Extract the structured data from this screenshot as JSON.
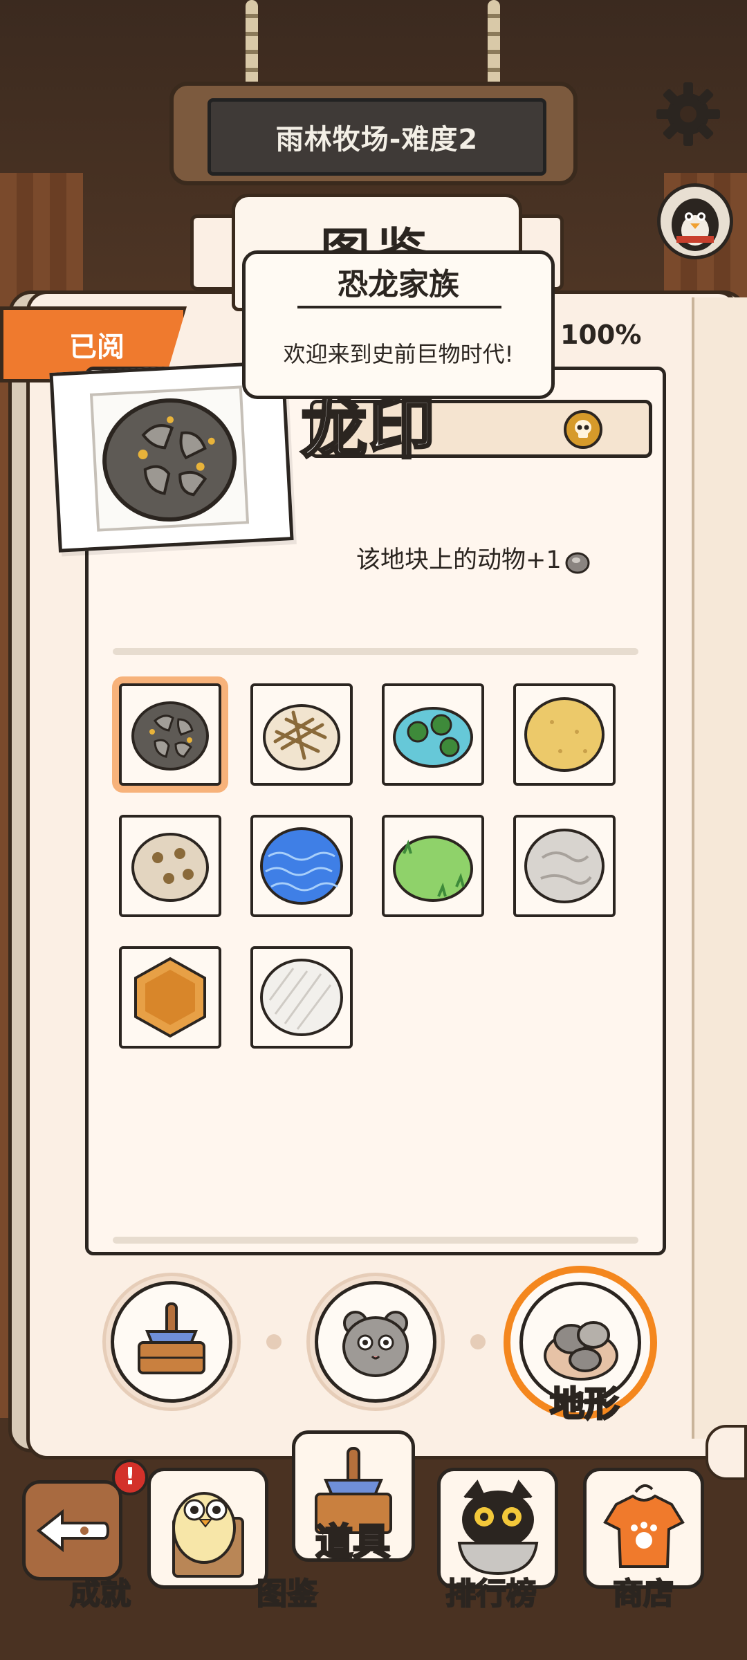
{
  "sign": {
    "title": "雨林牧场-难度2"
  },
  "book": {
    "header_title": "图鉴",
    "read_badge": "已阅",
    "progress": "100%"
  },
  "popup": {
    "title": "恐龙家族",
    "message": "欢迎来到史前巨物时代!"
  },
  "item": {
    "name": "龙印",
    "effect": "该地块上的动物+1"
  },
  "tiles": [
    {
      "name": "dragon-seal-tile",
      "selected": true
    },
    {
      "name": "straw-nest-tile",
      "selected": false
    },
    {
      "name": "lily-pond-tile",
      "selected": false
    },
    {
      "name": "sand-tile",
      "selected": false
    },
    {
      "name": "spider-web-tile",
      "selected": false
    },
    {
      "name": "water-tile",
      "selected": false
    },
    {
      "name": "grass-tile",
      "selected": false
    },
    {
      "name": "stone-tile",
      "selected": false
    },
    {
      "name": "honey-hex-tile",
      "selected": false
    },
    {
      "name": "blank-tile",
      "selected": false
    }
  ],
  "categories": {
    "terrain_label": "地形",
    "active": "terrain"
  },
  "nav": {
    "achievements": "成就",
    "gallery": "图鉴",
    "items": "道具",
    "ranking": "排行榜",
    "shop": "商店",
    "alert": "!"
  },
  "colors": {
    "accent_orange": "#ef7a2e",
    "selection_ring": "#f7b27a",
    "paper": "#fbefe4",
    "ink": "#2b2520"
  }
}
